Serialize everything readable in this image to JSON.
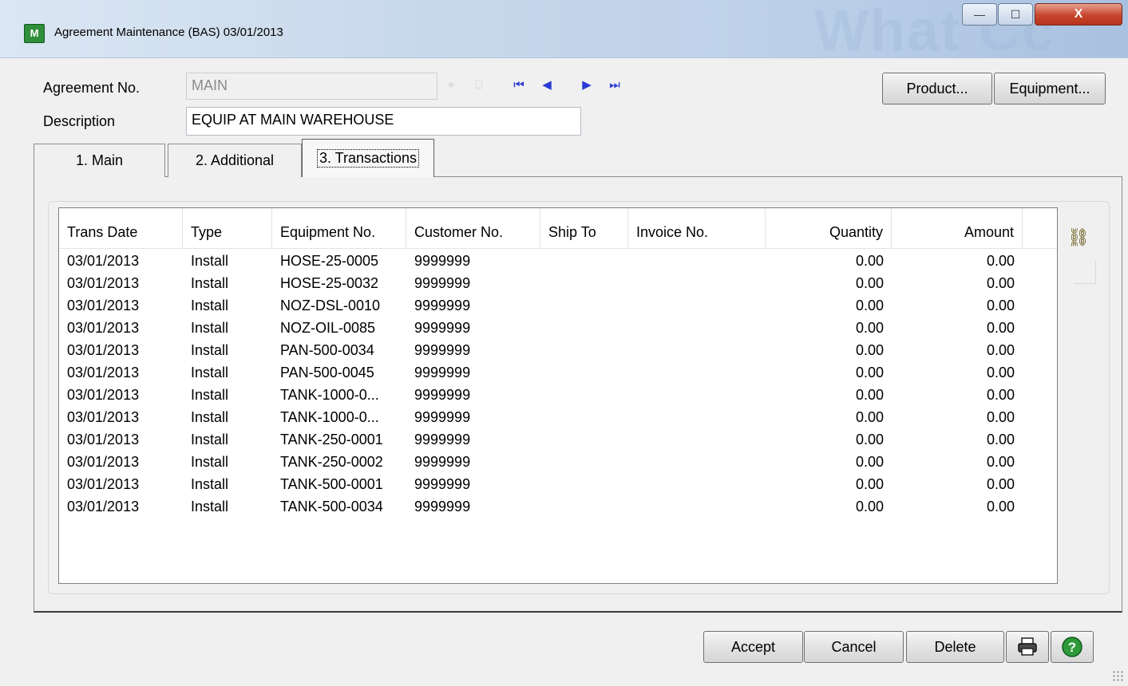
{
  "window": {
    "title": "Agreement Maintenance (BAS) 03/01/2013",
    "app_icon_text": "M",
    "watermark": "What Cc",
    "controls": {
      "minimize": "—",
      "maximize": "☐",
      "close": "X"
    }
  },
  "header": {
    "agreement_label": "Agreement No.",
    "agreement_value": "MAIN",
    "description_label": "Description",
    "description_value": "EQUIP AT MAIN WAREHOUSE",
    "product_button": "Product...",
    "equipment_button": "Equipment..."
  },
  "tabs": [
    {
      "label": "1. Main",
      "active": false
    },
    {
      "label": "2. Additional",
      "active": false
    },
    {
      "label": "3. Transactions",
      "active": true
    }
  ],
  "grid": {
    "columns": [
      "Trans Date",
      "Type",
      "Equipment No.",
      "Customer No.",
      "Ship To",
      "Invoice No.",
      "Quantity",
      "Amount"
    ],
    "rows": [
      [
        "03/01/2013",
        "Install",
        "HOSE-25-0005",
        "9999999",
        "",
        "",
        "0.00",
        "0.00"
      ],
      [
        "03/01/2013",
        "Install",
        "HOSE-25-0032",
        "9999999",
        "",
        "",
        "0.00",
        "0.00"
      ],
      [
        "03/01/2013",
        "Install",
        "NOZ-DSL-0010",
        "9999999",
        "",
        "",
        "0.00",
        "0.00"
      ],
      [
        "03/01/2013",
        "Install",
        "NOZ-OIL-0085",
        "9999999",
        "",
        "",
        "0.00",
        "0.00"
      ],
      [
        "03/01/2013",
        "Install",
        "PAN-500-0034",
        "9999999",
        "",
        "",
        "0.00",
        "0.00"
      ],
      [
        "03/01/2013",
        "Install",
        "PAN-500-0045",
        "9999999",
        "",
        "",
        "0.00",
        "0.00"
      ],
      [
        "03/01/2013",
        "Install",
        "TANK-1000-0...",
        "9999999",
        "",
        "",
        "0.00",
        "0.00"
      ],
      [
        "03/01/2013",
        "Install",
        "TANK-1000-0...",
        "9999999",
        "",
        "",
        "0.00",
        "0.00"
      ],
      [
        "03/01/2013",
        "Install",
        "TANK-250-0001",
        "9999999",
        "",
        "",
        "0.00",
        "0.00"
      ],
      [
        "03/01/2013",
        "Install",
        "TANK-250-0002",
        "9999999",
        "",
        "",
        "0.00",
        "0.00"
      ],
      [
        "03/01/2013",
        "Install",
        "TANK-500-0001",
        "9999999",
        "",
        "",
        "0.00",
        "0.00"
      ],
      [
        "03/01/2013",
        "Install",
        "TANK-500-0034",
        "9999999",
        "",
        "",
        "0.00",
        "0.00"
      ]
    ]
  },
  "footer": {
    "accept": "Accept",
    "cancel": "Cancel",
    "delete": "Delete"
  }
}
